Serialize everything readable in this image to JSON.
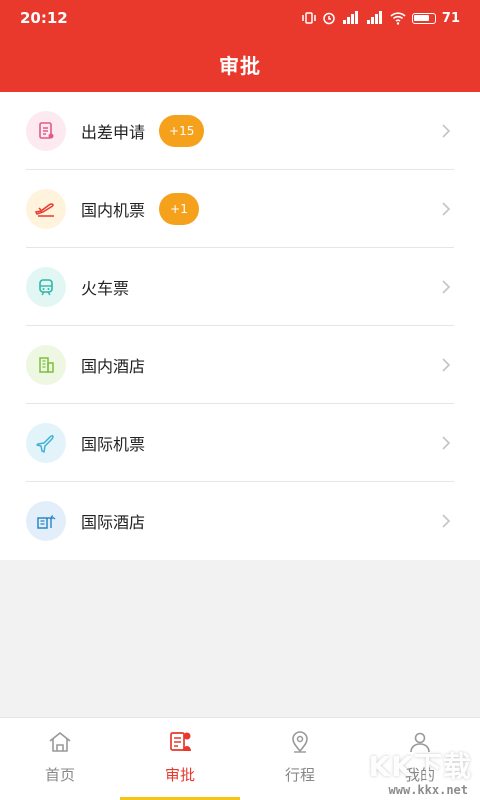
{
  "status_bar": {
    "time": "20:12",
    "battery": "71"
  },
  "header": {
    "title": "审批"
  },
  "list": [
    {
      "label": "出差申请",
      "badge": "+15",
      "icon": "document-icon",
      "icon_color": "#e15b8a",
      "icon_bg": "#fdeaf1"
    },
    {
      "label": "国内机票",
      "badge": "+1",
      "icon": "plane-takeoff-icon",
      "icon_color": "#e8392c",
      "icon_bg": "#fff3dd"
    },
    {
      "label": "火车票",
      "badge": "",
      "icon": "train-icon",
      "icon_color": "#2fb6a6",
      "icon_bg": "#e2f7f4"
    },
    {
      "label": "国内酒店",
      "badge": "",
      "icon": "hotel-building-icon",
      "icon_color": "#7fbf3f",
      "icon_bg": "#edf7e2"
    },
    {
      "label": "国际机票",
      "badge": "",
      "icon": "plane-icon",
      "icon_color": "#3fb1d6",
      "icon_bg": "#e2f4fa"
    },
    {
      "label": "国际酒店",
      "badge": "",
      "icon": "resort-hotel-icon",
      "icon_color": "#2d86c8",
      "icon_bg": "#e2eef9"
    }
  ],
  "tabs": [
    {
      "label": "首页",
      "icon": "home-icon",
      "active": false
    },
    {
      "label": "审批",
      "icon": "approval-icon",
      "active": true
    },
    {
      "label": "行程",
      "icon": "location-pin-icon",
      "active": false
    },
    {
      "label": "我的",
      "icon": "user-icon",
      "active": false
    }
  ],
  "watermark": {
    "main": "KK下载",
    "sub": "www.kkx.net"
  },
  "colors": {
    "primary": "#e8392c",
    "badge": "#f5a11c",
    "tab_indicator": "#f5c518"
  }
}
